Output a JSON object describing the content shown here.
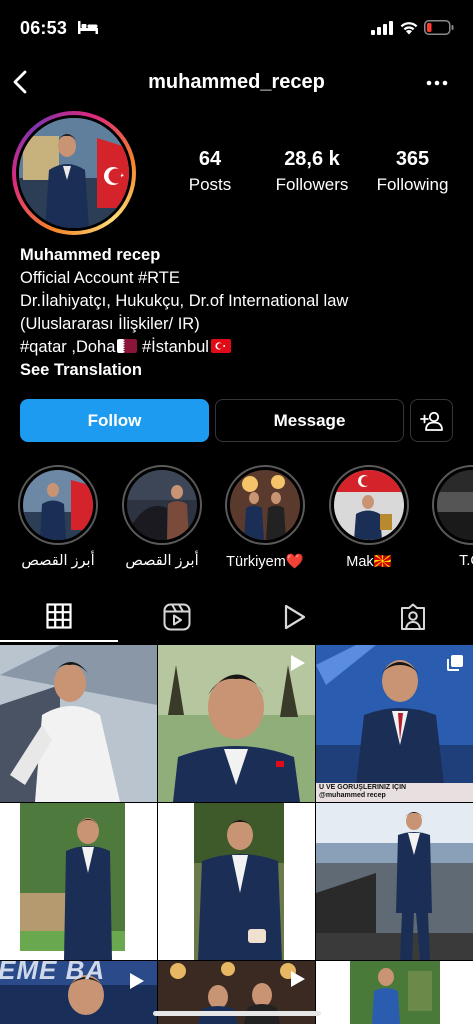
{
  "status": {
    "time": "06:53"
  },
  "nav": {
    "username": "muhammed_recep"
  },
  "stats": [
    {
      "value": "64",
      "label": "Posts"
    },
    {
      "value": "28,6 k",
      "label": "Followers"
    },
    {
      "value": "365",
      "label": "Following"
    }
  ],
  "bio": {
    "name": "Muhammed recep",
    "lines": [
      "Official Account #RTE",
      "Dr.İlahiyatçı, Hukukçu, Dr.of International law",
      "(Uluslararası İlişkiler/ IR)"
    ],
    "locations_a": "#qatar ,Doha",
    "locations_b": " #İstanbul",
    "see_translation": "See Translation"
  },
  "buttons": {
    "follow": "Follow",
    "message": "Message"
  },
  "highlights": [
    {
      "label": "أبرز القصص"
    },
    {
      "label": "أبرز القصص"
    },
    {
      "label": "Türkiyem❤️"
    },
    {
      "label": "Mak🇲🇰"
    },
    {
      "label": "T.C."
    }
  ],
  "tabs": [
    "grid-icon",
    "reels-icon",
    "play-icon",
    "tagged-icon"
  ],
  "posts": {
    "p3_caption_1": "U VE GÖRÜŞLERİNİZ İÇİN",
    "p3_caption_2": "@muhammed recep",
    "p7_banner": "EME BA"
  },
  "colors": {
    "accent": "#1d9bf0",
    "border": "#363636",
    "battery_low": "#ff3b30"
  }
}
